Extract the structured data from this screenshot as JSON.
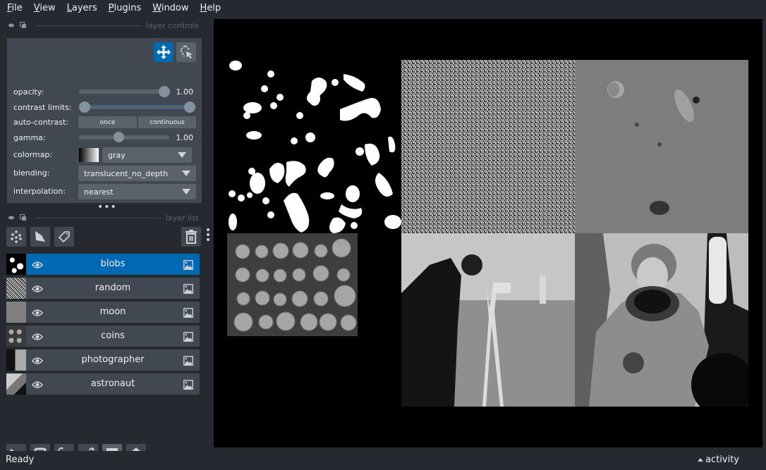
{
  "menu": [
    {
      "label": "File",
      "mnemonic": "F",
      "rest": "ile"
    },
    {
      "label": "View",
      "mnemonic": "V",
      "rest": "iew"
    },
    {
      "label": "Layers",
      "mnemonic": "L",
      "rest": "ayers"
    },
    {
      "label": "Plugins",
      "mnemonic": "P",
      "rest": "lugins"
    },
    {
      "label": "Window",
      "mnemonic": "W",
      "rest": "indow"
    },
    {
      "label": "Help",
      "mnemonic": "H",
      "rest": "elp"
    }
  ],
  "layer_controls": {
    "title": "layer controls",
    "opacity": {
      "label": "opacity:",
      "value": 1.0,
      "display": "1.00"
    },
    "contrast_limits": {
      "label": "contrast limits:",
      "low": 0.0,
      "high": 1.0
    },
    "auto_contrast": {
      "label": "auto-contrast:",
      "once": "once",
      "continuous": "continuous"
    },
    "gamma": {
      "label": "gamma:",
      "value": 1.0,
      "display": "1.00",
      "min": 0.2,
      "max": 2.0
    },
    "colormap": {
      "label": "colormap:",
      "value": "gray"
    },
    "blending": {
      "label": "blending:",
      "value": "translucent_no_depth"
    },
    "interpolation": {
      "label": "interpolation:",
      "value": "nearest"
    },
    "modes": {
      "pan_zoom": "pan-zoom",
      "transform": "transform"
    }
  },
  "layer_list": {
    "title": "layer list",
    "layers": [
      {
        "name": "blobs",
        "visible": true,
        "selected": true,
        "type": "image"
      },
      {
        "name": "random",
        "visible": true,
        "selected": false,
        "type": "image"
      },
      {
        "name": "moon",
        "visible": true,
        "selected": false,
        "type": "image"
      },
      {
        "name": "coins",
        "visible": true,
        "selected": false,
        "type": "image"
      },
      {
        "name": "photographer",
        "visible": true,
        "selected": false,
        "type": "image"
      },
      {
        "name": "astronaut",
        "visible": true,
        "selected": false,
        "type": "image"
      }
    ]
  },
  "colors": {
    "background": "#262930",
    "panel": "#414851",
    "control": "#5a626c",
    "accent": "#0069b4",
    "text": "#f0f1f2"
  },
  "status": {
    "text": "Ready",
    "activity": "activity"
  }
}
